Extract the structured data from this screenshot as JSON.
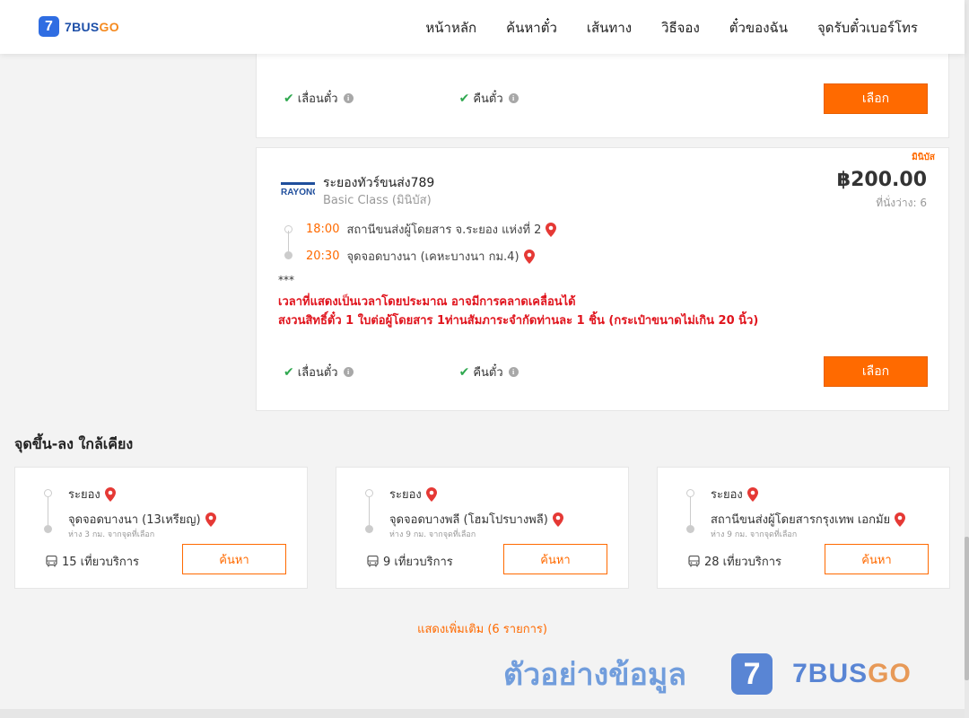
{
  "brand": {
    "logo_digit": "7",
    "name_main": "7BUS",
    "name_go": "GO"
  },
  "nav": {
    "home": "หน้าหลัก",
    "search": "ค้นหาตั๋ว",
    "routes": "เส้นทาง",
    "how_to_book": "วิธีจอง",
    "my_tickets": "ตั๋วของฉัน",
    "phone_pickup": "จุดรับตั๋วเบอร์โทร"
  },
  "prev_card": {
    "feature_change": "เลื่อนตั๋ว",
    "feature_refund": "คืนตั๋ว",
    "select_label": "เลือก"
  },
  "trip": {
    "badge": "มินิบัส",
    "operator_logo_text": "RAYONG",
    "operator_name": "ระยองทัวร์ขนส่ง789",
    "class": "Basic Class (มินิบัส)",
    "price": "฿200.00",
    "seats": "ที่นั่งว่าง: 6",
    "departure_time": "18:00",
    "departure_stop": "สถานีขนส่งผู้โดยสาร จ.ระยอง แห่งที่ 2",
    "arrival_time": "20:30",
    "arrival_stop": "จุดจอดบางนา (เคหะบางนา กม.4)",
    "note_stars": "***",
    "note_line1": "เวลาที่แสดงเป็นเวลาโดยประมาณ อาจมีการคลาดเคลื่อนได้",
    "note_line2": "สงวนสิทธิ์ตั๋ว 1 ใบต่อผู้โดยสาร 1ท่านสัมภาระจำกัดท่านละ 1 ชิ้น (กระเป๋าขนาดไม่เกิน 20 นิ้ว)",
    "feature_change": "เลื่อนตั๋ว",
    "feature_refund": "คืนตั๋ว",
    "select_label": "เลือก"
  },
  "nearby": {
    "title": "จุดขึ้น-ลง ใกล้เคียง",
    "cards": [
      {
        "from": "ระยอง",
        "to": "จุดจอดบางนา (13เหรียญ)",
        "distance": "ห่าง 3 กม. จากจุดที่เลือก",
        "count": "15 เที่ยวบริการ",
        "button": "ค้นหา"
      },
      {
        "from": "ระยอง",
        "to": "จุดจอดบางพลี (โฮมโปรบางพลี)",
        "distance": "ห่าง 9 กม. จากจุดที่เลือก",
        "count": "9 เที่ยวบริการ",
        "button": "ค้นหา"
      },
      {
        "from": "ระยอง",
        "to": "สถานีขนส่งผู้โดยสารกรุงเทพ เอกมัย",
        "distance": "ห่าง 9 กม. จากจุดที่เลือก",
        "count": "28 เที่ยวบริการ",
        "button": "ค้นหา"
      }
    ],
    "show_more": "แสดงเพิ่มเติม (6 รายการ)"
  },
  "watermark": {
    "text": "ตัวอย่างข้อมูล",
    "digit": "7",
    "brand_main": "7BUS",
    "brand_go": "GO"
  },
  "colors": {
    "accent": "#ff6a00",
    "brand_blue": "#2f6de2",
    "alert_red": "#e0141d",
    "check_green": "#2fa84f"
  }
}
